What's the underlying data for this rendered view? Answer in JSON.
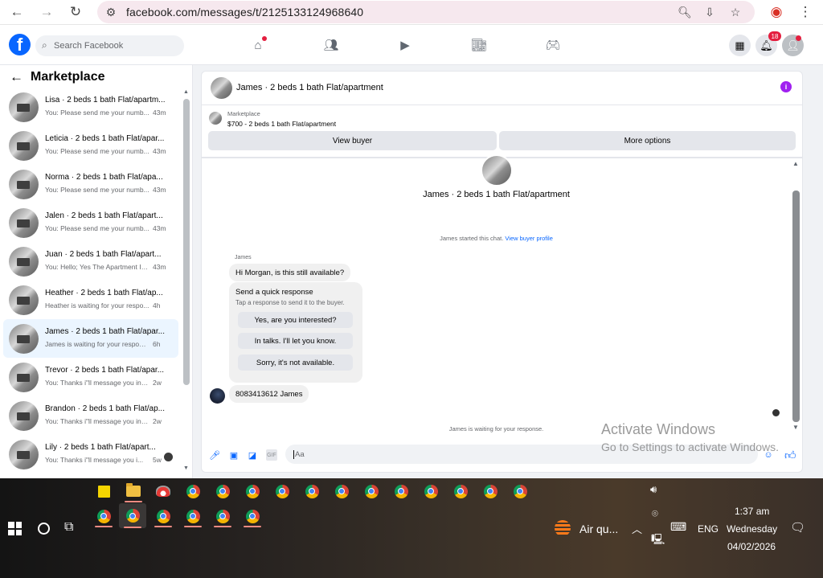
{
  "browser": {
    "url": "facebook.com/messages/t/2125133124968640"
  },
  "fb": {
    "logo": "f",
    "search_placeholder": "Search Facebook",
    "notifications_count": "18"
  },
  "sidebar": {
    "title": "Marketplace",
    "conversations": [
      {
        "name": "Lisa · 2 beds 1 bath Flat/apartm...",
        "snippet": "You: Please send me your numb...",
        "time": "43m"
      },
      {
        "name": "Leticia · 2 beds 1 bath Flat/apar...",
        "snippet": "You: Please send me your numb...",
        "time": "43m"
      },
      {
        "name": "Norma · 2 beds 1 bath Flat/apa...",
        "snippet": "You: Please send me your numb...",
        "time": "43m"
      },
      {
        "name": "Jalen · 2 beds 1 bath Flat/apart...",
        "snippet": "You: Please send me your numb...",
        "time": "43m"
      },
      {
        "name": "Juan · 2 beds 1 bath Flat/apart...",
        "snippet": "You: Hello; Yes The Apartment Is...",
        "time": "43m"
      },
      {
        "name": "Heather · 2 beds 1 bath Flat/ap...",
        "snippet": "Heather is waiting for your respo...",
        "time": "4h"
      },
      {
        "name": "James · 2 beds 1 bath Flat/apar...",
        "snippet": "James is waiting for your response.",
        "time": "6h"
      },
      {
        "name": "Trevor · 2 beds 1 bath Flat/apar...",
        "snippet": "You: Thanks i\"ll message you in a ...",
        "time": "2w"
      },
      {
        "name": "Brandon · 2 beds 1 bath Flat/ap...",
        "snippet": "You: Thanks i\"ll message you in a ...",
        "time": "2w"
      },
      {
        "name": "Lily · 2 beds 1 bath Flat/apart...",
        "snippet": "You: Thanks i\"ll message you i...",
        "time": "5w"
      }
    ]
  },
  "chat": {
    "title": "James · 2 beds 1 bath Flat/apartment",
    "listing_label": "Marketplace",
    "listing_title": "$700 - 2 beds 1 bath Flat/apartment",
    "view_buyer": "View buyer",
    "more_options": "More options",
    "big_title": "James · 2 beds 1 bath Flat/apartment",
    "started_text": "James started this chat.",
    "view_profile": "View buyer profile",
    "sender": "James",
    "first_message": "Hi Morgan, is this still available?",
    "quick_title": "Send a quick response",
    "quick_sub": "Tap a response to send it to the buyer.",
    "quick_options": [
      "Yes, are you interested?",
      "In talks. I'll let you know.",
      "Sorry, it's not available."
    ],
    "user_message": "8083413612 James",
    "waiting_text": "James is waiting for your response.",
    "composer_placeholder": "Aa",
    "gif_label": "GIF"
  },
  "watermark": {
    "line1": "Activate Windows",
    "line2": "Go to Settings to activate Windows."
  },
  "taskbar": {
    "weather": "Air qu...",
    "language": "ENG",
    "time": "1:37 am",
    "day": "Wednesday",
    "date": "04/02/2026"
  },
  "colors": {
    "fb_blue": "#0866ff",
    "badge_red": "#e41e3f",
    "info_purple": "#a020f0"
  }
}
